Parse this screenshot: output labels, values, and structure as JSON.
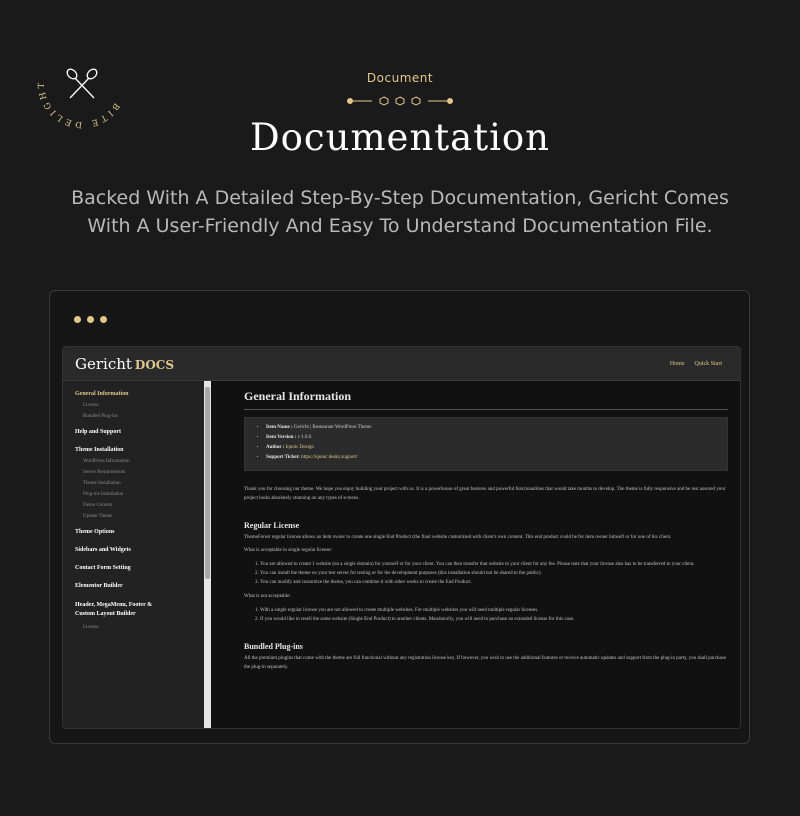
{
  "logo": {
    "arc_text": "BITE DELIGHT IN EVERY"
  },
  "header": {
    "kicker": "Document",
    "title": "Documentation",
    "subtitle": "Backed With A Detailed Step-By-Step Documentation, Gericht Comes With A User-Friendly And Easy To Understand Documentation File."
  },
  "colors": {
    "accent": "#e2c88f",
    "background": "#1a1a1a"
  },
  "app": {
    "brand": "Gericht",
    "brand_suffix": "DOCS",
    "nav": [
      "Home",
      "Quick Start"
    ],
    "sidebar": {
      "groups": [
        {
          "label": "General Information",
          "active": true,
          "items": [
            "License",
            "Bundled Plug-ins"
          ]
        },
        {
          "label": "Help and Support",
          "items": []
        },
        {
          "label": "Theme Installation",
          "items": [
            "WordPress Information",
            "Server Requirements",
            "Theme Installation",
            "Plug-ins Installation",
            "Demo Content",
            "Update Theme"
          ]
        },
        {
          "label": "Theme Options",
          "items": []
        },
        {
          "label": "Sidebars and Widgets",
          "items": []
        },
        {
          "label": "Contact Form Setting",
          "items": []
        },
        {
          "label": "Elementor Builder",
          "items": []
        },
        {
          "label": "Header, MegaMenu, Footer & Custom Layout Builder",
          "items": [
            "License"
          ]
        }
      ]
    },
    "content": {
      "title": "General Information",
      "info": {
        "item_name_label": "Item Name :",
        "item_name": "Gericht | Restaurant WordPress Theme",
        "item_version_label": "Item Version :",
        "item_version": "v 1.0.0",
        "author_label": "Author :",
        "author": "Iqonic Design",
        "support_label": "Support Ticket:",
        "support": "https://iqonic.desky.support/"
      },
      "intro": "Thank you for choosing our theme. We hope you enjoy building your project with us. It is a powerhouse of great features and powerful functionalities that would take months to develop. The theme is fully responsive and be rest assured your project looks absolutely stunning on any types of screens.",
      "regular_license": {
        "heading": "Regular License",
        "desc": "ThemeForest regular license allows an item owner to create one single End Product (the final website customized with client's own content. This end product could be for item owner himself or for one of his client.",
        "acceptable_label": "What is acceptable in single regular license:",
        "acceptable": [
          "You are allowed to create 1 website (on a single domain) for yourself or for your client. You can then transfer that website to your client for any fee. Please note that your license also has to be transferred to your client.",
          "You can install the theme on your test server for testing or for the development purposes (this installation should not be shared to the public).",
          "You can modify and customize the theme, you can combine it with other works to create the End Product."
        ],
        "not_acceptable_label": "What is not acceptable:",
        "not_acceptable": [
          "With a single regular license you are not allowed to create multiple websites. For multiple websites you will need multiple regular licenses.",
          "If you would like to resell the same website (Single End Product) to another clients. Mandatorily, you will need to purchase an extended license for this case."
        ]
      },
      "bundled": {
        "heading": "Bundled Plug-ins",
        "desc": "All the premium plugins that come with the theme are full functional without any registration license key. If however, you wish to use the additional features or receive automatic updates and support from the plug-in party, you shall purchase the plug-in separately."
      }
    }
  }
}
